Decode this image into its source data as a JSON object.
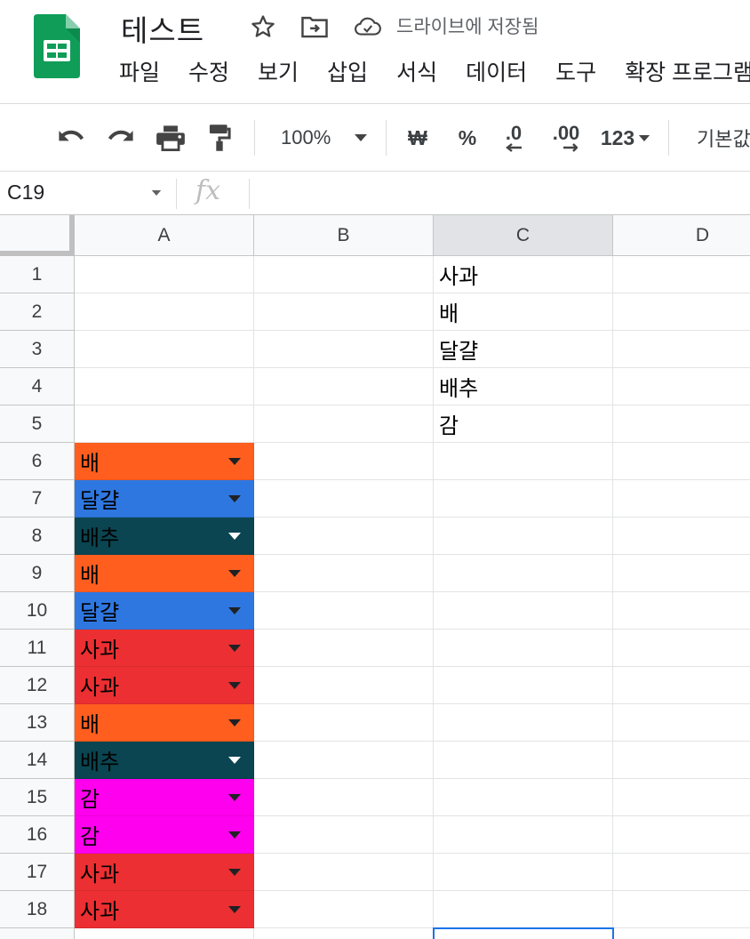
{
  "title_bar": {
    "doc_title": "테스트",
    "save_status": "드라이브에 저장됨"
  },
  "menu": [
    "파일",
    "수정",
    "보기",
    "삽입",
    "서식",
    "데이터",
    "도구",
    "확장 프로그램"
  ],
  "toolbar": {
    "zoom": "100%",
    "currency": "₩",
    "percent": "%",
    "decrease_decimal": ".0",
    "increase_decimal": ".00",
    "number_format": "123",
    "font": "기본값"
  },
  "formula_bar": {
    "cell_ref": "C19"
  },
  "columns": [
    "A",
    "B",
    "C",
    "D"
  ],
  "selected_column": "C",
  "rows": [
    "1",
    "2",
    "3",
    "4",
    "5",
    "6",
    "7",
    "8",
    "9",
    "10",
    "11",
    "12",
    "13",
    "14",
    "15",
    "16",
    "17",
    "18"
  ],
  "column_c_values": [
    "사과",
    "배",
    "달걀",
    "배추",
    "감"
  ],
  "column_a_chips": [
    {
      "row": "6",
      "value": "배",
      "color": "#ff5e1f"
    },
    {
      "row": "7",
      "value": "달걀",
      "color": "#2f77e0"
    },
    {
      "row": "8",
      "value": "배추",
      "color": "#0a4551"
    },
    {
      "row": "9",
      "value": "배",
      "color": "#ff5e1f"
    },
    {
      "row": "10",
      "value": "달걀",
      "color": "#2f77e0"
    },
    {
      "row": "11",
      "value": "사과",
      "color": "#ec2f32"
    },
    {
      "row": "12",
      "value": "사과",
      "color": "#ec2f32"
    },
    {
      "row": "13",
      "value": "배",
      "color": "#ff5e1f"
    },
    {
      "row": "14",
      "value": "배추",
      "color": "#0a4551"
    },
    {
      "row": "15",
      "value": "감",
      "color": "#ff00ee"
    },
    {
      "row": "16",
      "value": "감",
      "color": "#ff00ee"
    },
    {
      "row": "17",
      "value": "사과",
      "color": "#ec2f32"
    },
    {
      "row": "18",
      "value": "사과",
      "color": "#ec2f32"
    }
  ],
  "colors": {
    "selection": "#1a73e8",
    "sheets_green": "#0f9d58"
  }
}
